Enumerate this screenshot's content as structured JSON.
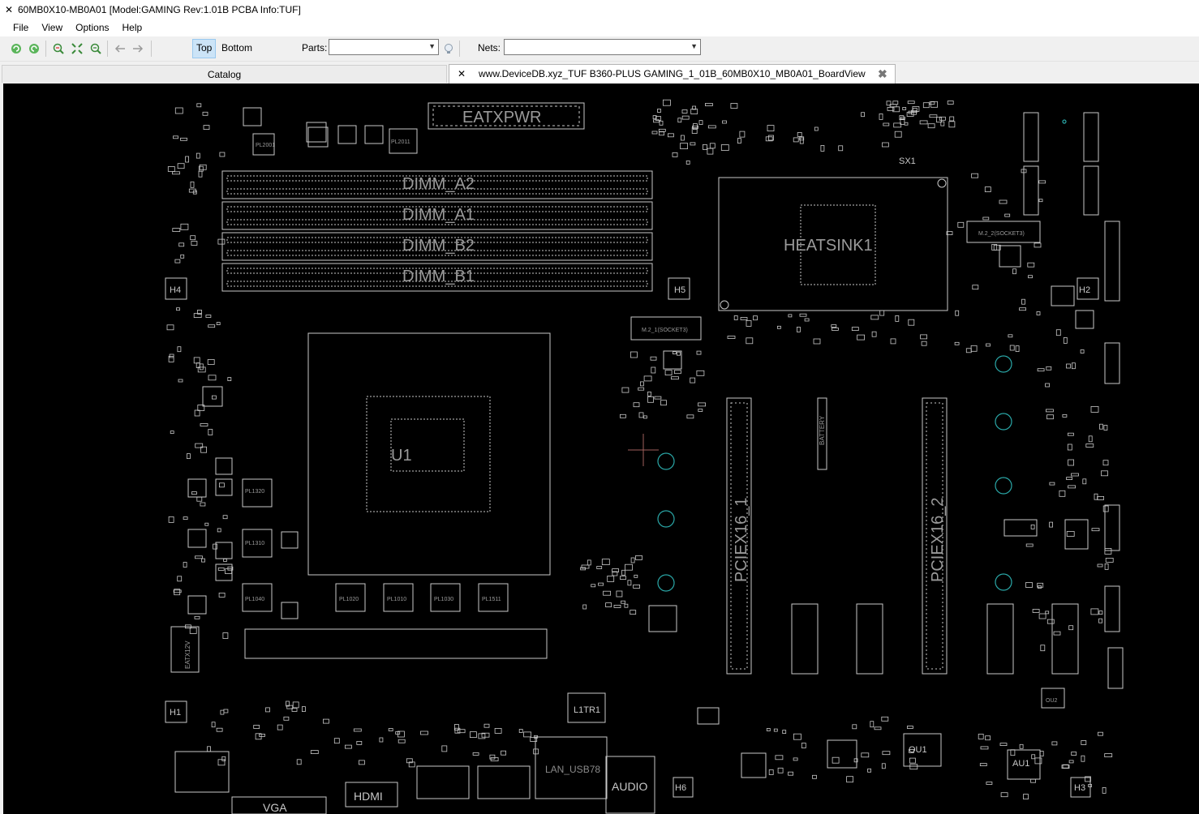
{
  "window": {
    "title": "60MB0X10-MB0A01 [Model:GAMING Rev:1.01B PCBA Info:TUF]"
  },
  "menu": [
    "File",
    "View",
    "Options",
    "Help"
  ],
  "toolbar": {
    "side_top": "Top",
    "side_bottom": "Bottom",
    "parts_label": "Parts:",
    "parts_value": "",
    "nets_label": "Nets:",
    "nets_value": ""
  },
  "tabs": {
    "catalog": "Catalog",
    "board": "www.DeviceDB.xyz_TUF B360-PLUS GAMING_1_01B_60MB0X10_MB0A01_BoardView"
  },
  "board": {
    "labels": {
      "eatxpwr": "EATXPWR",
      "dimm_a2": "DIMM_A2",
      "dimm_a1": "DIMM_A1",
      "dimm_b2": "DIMM_B2",
      "dimm_b1": "DIMM_B1",
      "heatsink": "HEATSINK1",
      "m2_1": "M.2_1(SOCKET3)",
      "m2_2": "M.2_2(SOCKET3)",
      "pciex16_1": "PCIEX16_1",
      "pciex16_2": "PCIEX16_2",
      "battery": "BATTERY",
      "hdmi": "HDMI",
      "vga": "VGA",
      "audio": "AUDIO",
      "lan_usb": "LAN_USB78",
      "l1tr1": "L1TR1",
      "ou1": "OU1",
      "au1": "AU1",
      "ou2": "OU2",
      "eatx12v": "EATX12V",
      "sx1": "SX1",
      "u1": "U1",
      "pl1320": "PL1320",
      "pl1310": "PL1310",
      "pl1040": "PL1040",
      "pl1020": "PL1020",
      "pl1010": "PL1010",
      "pl1030": "PL1030",
      "pl1511": "PL1511",
      "pl2011": "PL2011",
      "pl2001": "PL2001",
      "h1": "H1",
      "h2": "H2",
      "h3": "H3",
      "h4": "H4",
      "h5": "H5",
      "h6": "H6"
    }
  },
  "colors": {
    "trace": "#c8c8c8",
    "canvas_bg": "#000000",
    "mounting_hole": "#2aa7a7",
    "crosshair": "#a0615b"
  }
}
